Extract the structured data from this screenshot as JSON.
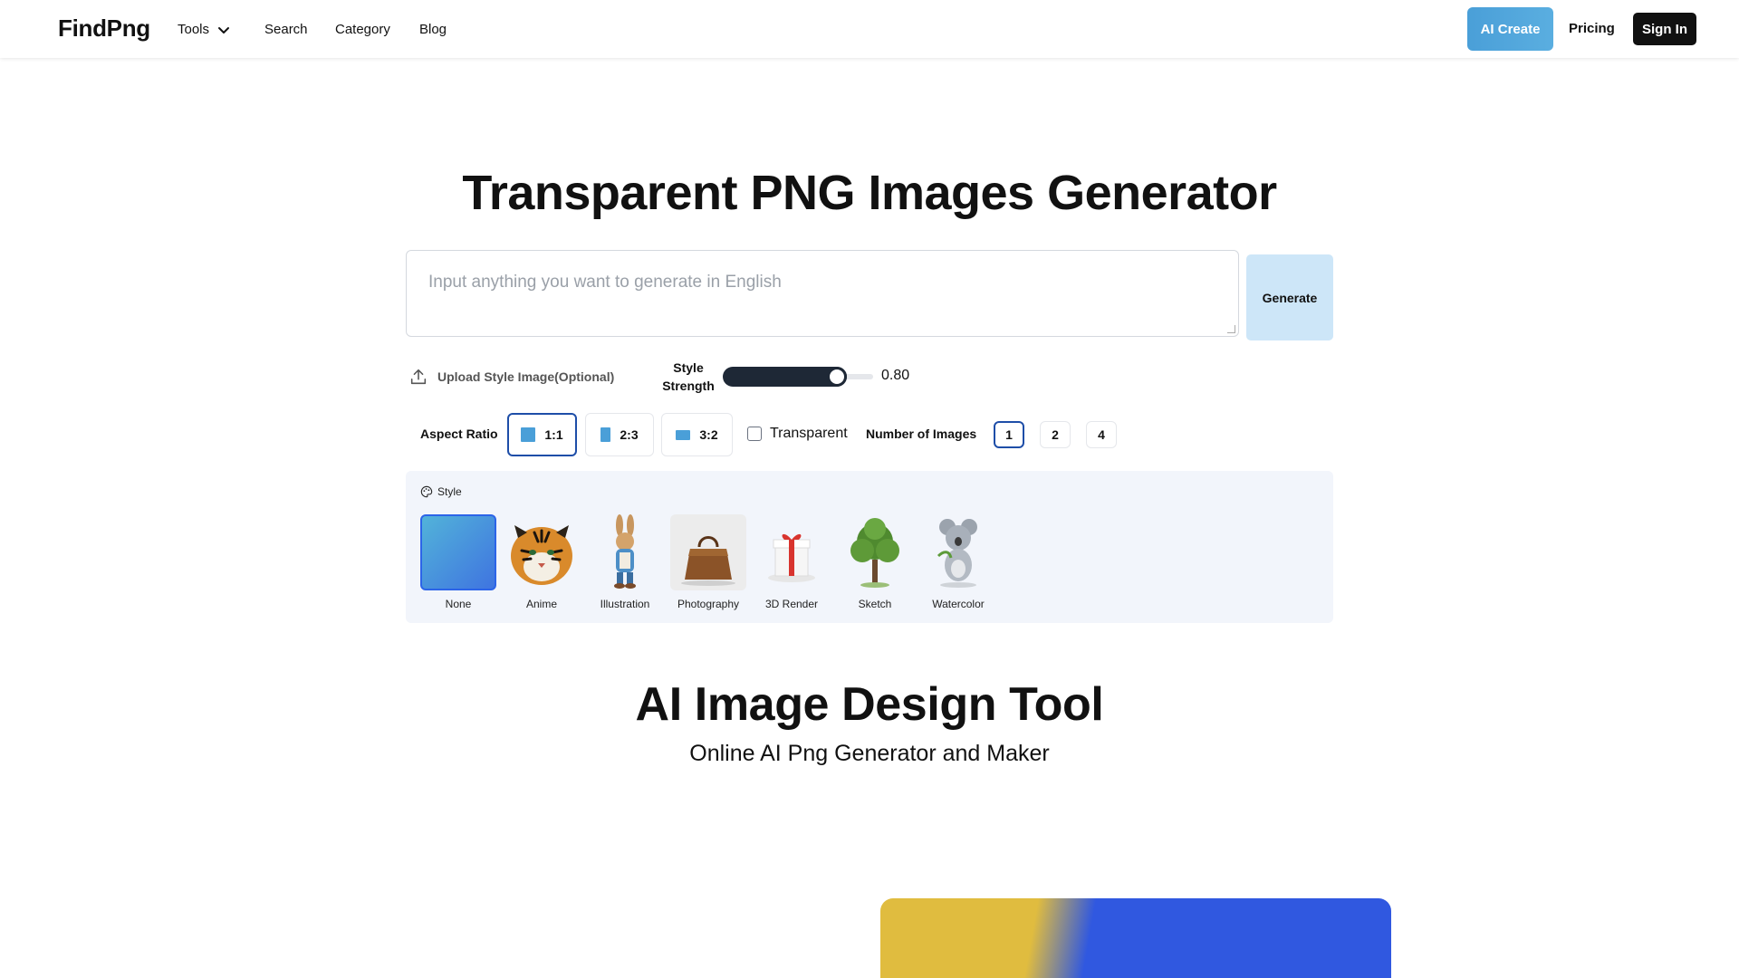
{
  "nav": {
    "logo": "FindPng",
    "links": [
      {
        "label": "Tools"
      },
      {
        "label": "Search"
      },
      {
        "label": "Category"
      },
      {
        "label": "Blog"
      }
    ],
    "ai_create": "AI Create",
    "pricing": "Pricing",
    "sign_in": "Sign In"
  },
  "hero": {
    "title": "Transparent PNG Images Generator",
    "prompt_placeholder": "Input anything you want to generate in English",
    "generate_label": "Generate",
    "upload_label": "Upload Style Image(Optional)",
    "strength_label": "Style Strength",
    "strength_value": "0.80",
    "strength_fraction": 0.8
  },
  "options": {
    "aspect_label": "Aspect Ratio",
    "ratios": [
      "1:1",
      "2:3",
      "3:2"
    ],
    "ratio_selected": "1:1",
    "transparent_label": "Transparent",
    "transparent_checked": false,
    "num_images_label": "Number of Images",
    "num_images": [
      "1",
      "2",
      "4"
    ],
    "num_selected": "1"
  },
  "style": {
    "heading": "Style",
    "items": [
      "None",
      "Anime",
      "Illustration",
      "Photography",
      "3D Render",
      "Sketch",
      "Watercolor"
    ],
    "selected": "None"
  },
  "section2": {
    "title": "AI Image Design Tool",
    "subtitle": "Online AI Png Generator and Maker"
  },
  "colors": {
    "accent": "#4a9fd8",
    "selected_border": "#1e4ea8",
    "dark": "#111111",
    "panel_bg": "#f2f5fb"
  }
}
